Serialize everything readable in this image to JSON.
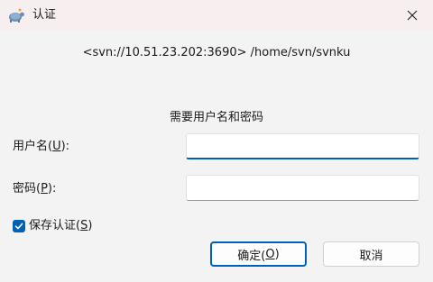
{
  "window": {
    "title": "认证",
    "icon": "tortoise-svn-icon",
    "close_icon": "close-icon"
  },
  "dialog": {
    "repo_url": "<svn://10.51.23.202:3690> /home/svn/svnku",
    "prompt": "需要用户名和密码"
  },
  "fields": {
    "username": {
      "label_prefix": "用户名(",
      "accel": "U",
      "label_suffix": "):",
      "value": ""
    },
    "password": {
      "label_prefix": "密码(",
      "accel": "P",
      "label_suffix": "):",
      "value": ""
    }
  },
  "save_auth": {
    "checked": true,
    "label_prefix": "保存认证(",
    "accel": "S",
    "label_suffix": ")"
  },
  "buttons": {
    "ok": {
      "prefix": "确定(",
      "accel": "O",
      "suffix": ")"
    },
    "cancel": {
      "label": "取消"
    }
  },
  "colors": {
    "accent": "#005fb8",
    "titlebar": "#f7eef0",
    "background": "#f3f3f3"
  }
}
